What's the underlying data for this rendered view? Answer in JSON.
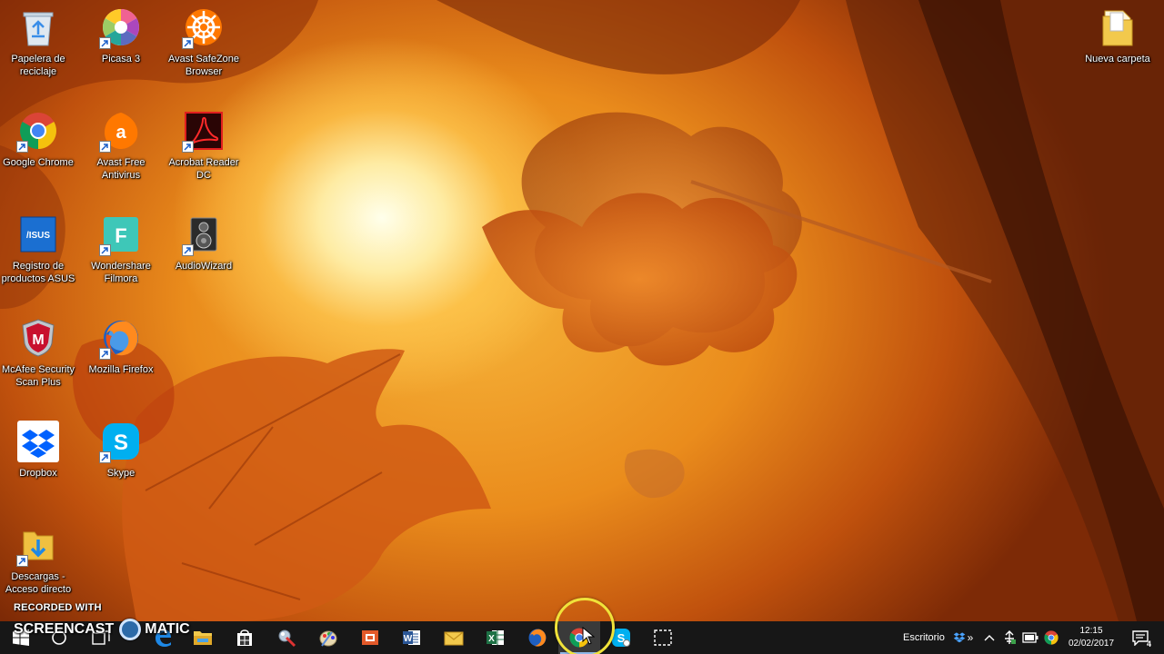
{
  "desktop": {
    "icons": [
      {
        "label": "Papelera de reciclaje",
        "icon": "recycle-bin-icon"
      },
      {
        "label": "Picasa 3",
        "icon": "picasa-icon"
      },
      {
        "label": "Avast SafeZone Browser",
        "icon": "avast-safezone-icon"
      },
      {
        "label": "Google Chrome",
        "icon": "chrome-icon"
      },
      {
        "label": "Avast Free Antivirus",
        "icon": "avast-antivirus-icon"
      },
      {
        "label": "Acrobat Reader DC",
        "icon": "acrobat-reader-icon"
      },
      {
        "label": "Registro de productos ASUS",
        "icon": "asus-icon"
      },
      {
        "label": "Wondershare Filmora",
        "icon": "filmora-icon"
      },
      {
        "label": "AudioWizard",
        "icon": "audiowizard-icon"
      },
      {
        "label": "McAfee Security Scan Plus",
        "icon": "mcafee-icon"
      },
      {
        "label": "Mozilla Firefox",
        "icon": "firefox-icon"
      },
      {
        "label": "Dropbox",
        "icon": "dropbox-icon"
      },
      {
        "label": "Skype",
        "icon": "skype-icon"
      },
      {
        "label": "Descargas - Acceso directo",
        "icon": "downloads-folder-icon"
      },
      {
        "label": "Nueva carpeta",
        "icon": "folder-icon"
      }
    ]
  },
  "watermark": {
    "line1": "RECORDED WITH",
    "line2a": "SCREENCAST",
    "line2b": "MATIC"
  },
  "taskbar": {
    "pinned": [
      "start-icon",
      "search-icon",
      "task-view-icon",
      "edge-icon",
      "file-explorer-icon",
      "store-icon",
      "paint-tool-icon",
      "color-app-icon",
      "office-icon",
      "word-icon",
      "mail-icon",
      "excel-icon",
      "firefox-icon",
      "chrome-icon",
      "skype-icon",
      "snipping-icon"
    ],
    "toolbar_label": "Escritorio",
    "toolbar_chevron": "»",
    "time": "12:15",
    "date": "02/02/2017",
    "notification_count": "4"
  },
  "colors": {
    "taskbar_bg": "#171717",
    "highlight_ring": "#f0e23a",
    "active_indicator": "#8fb8e8"
  }
}
